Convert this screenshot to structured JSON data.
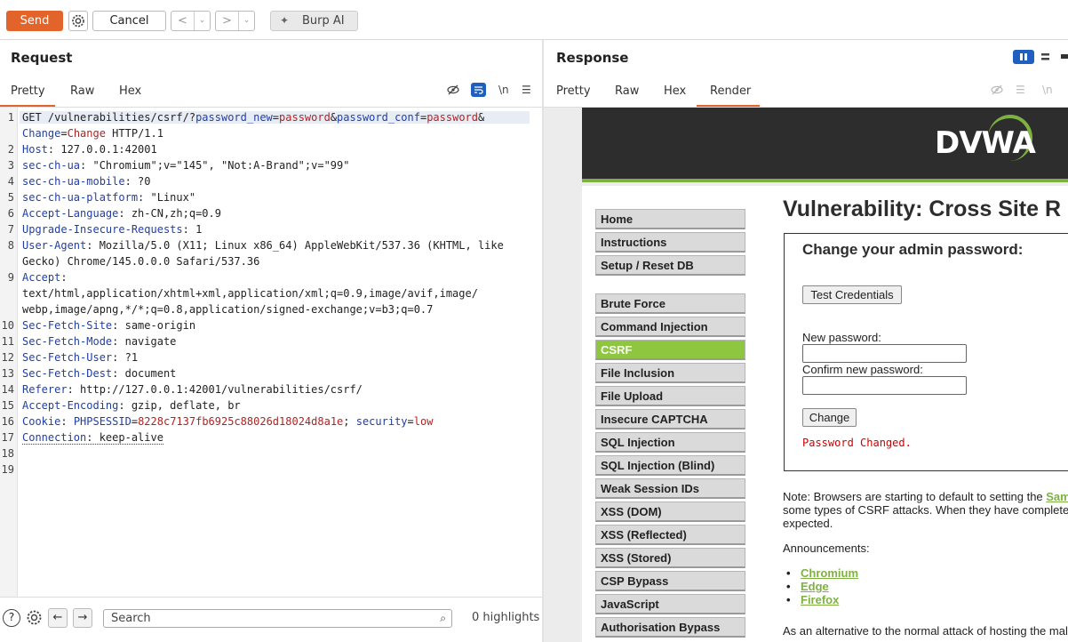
{
  "toolbar": {
    "send": "Send",
    "cancel": "Cancel",
    "back": "<",
    "forward": ">",
    "burp_ai": "Burp AI"
  },
  "request": {
    "title": "Request",
    "tabs": [
      "Pretty",
      "Raw",
      "Hex"
    ],
    "active_tab": "Pretty",
    "toolbar_icons": [
      "eye-off-icon",
      "wrap-icon",
      "newline-icon",
      "menu-icon"
    ]
  },
  "response": {
    "title": "Response",
    "tabs": [
      "Pretty",
      "Raw",
      "Hex",
      "Render"
    ],
    "active_tab": "Render"
  },
  "editor": {
    "line_numbers": [
      "1",
      "",
      "2",
      "3",
      "4",
      "5",
      "6",
      "7",
      "8",
      "",
      "9",
      "",
      "",
      "10",
      "11",
      "12",
      "13",
      "14",
      "15",
      "16",
      "17",
      "18",
      "19"
    ]
  },
  "search": {
    "placeholder": "Search",
    "highlights": "0 highlights"
  },
  "dvwa": {
    "logo": "DVWA",
    "menu": [
      "Home",
      "Instructions",
      "Setup / Reset DB",
      "Brute Force",
      "Command Injection",
      "CSRF",
      "File Inclusion",
      "File Upload",
      "Insecure CAPTCHA",
      "SQL Injection",
      "SQL Injection (Blind)",
      "Weak Session IDs",
      "XSS (DOM)",
      "XSS (Reflected)",
      "XSS (Stored)",
      "CSP Bypass",
      "JavaScript",
      "Authorisation Bypass"
    ],
    "selected_menu": "CSRF",
    "title": "Vulnerability: Cross Site R",
    "form_heading": "Change your admin password:",
    "test_credentials": "Test Credentials",
    "new_password_label": "New password:",
    "confirm_password_label": "Confirm new password:",
    "change_button": "Change",
    "result": "Password Changed.",
    "note_line1": "Note: Browsers are starting to default to setting the ",
    "note_link": "Sam",
    "note_line2": "some types of CSRF attacks. When they have complete",
    "note_line3": "expected.",
    "announcements": "Announcements:",
    "links": [
      "Chromium",
      "Edge",
      "Firefox"
    ],
    "footer_line": "As an alternative to the normal attack of hosting the mal"
  },
  "colors": {
    "send": "#e3642b",
    "dvwa_green": "#8ec640",
    "key_blue": "#1f3fa6",
    "value_red": "#b22222"
  }
}
